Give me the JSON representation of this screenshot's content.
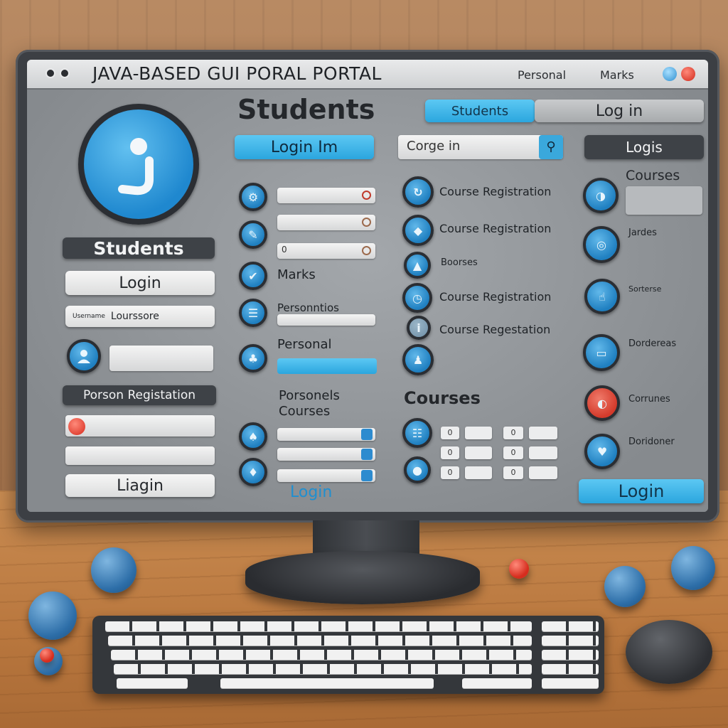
{
  "window": {
    "title": "JAVA-BASED GUI PORAL PORTAL",
    "nav_personal": "Personal",
    "nav_marks": "Marks"
  },
  "left": {
    "students_heading": "Students",
    "login_button": "Login",
    "field_loursstore": "Lourssore",
    "field_loursstore_prefix": "Username",
    "person_registration": "Porson Registation",
    "ligin_button": "Liagin"
  },
  "center": {
    "students_heading": "Students",
    "login_in_button": "Login Im",
    "marks_label": "Marks",
    "personal_label": "Personal",
    "persons_label": "Personntios",
    "personals_courses_label": "Porsonels Courses",
    "login_button": "Login",
    "field_zero": "0"
  },
  "right": {
    "students_tab": "Students",
    "login_tab": "Log in",
    "search_placeholder": "Corge in",
    "logis_button": "Logis",
    "course_registration_1": "Course Registration",
    "course_registration_2": "Course Registration",
    "course_reg_3": "Boorses",
    "course_registration_4": "Course Registration",
    "course_registration_5": "Course Regestation",
    "courses_heading": "Courses",
    "courses_title": "Courses",
    "jardes": "Jardes",
    "sorterse": "Sorterse",
    "docdereas": "Dordereas",
    "corrunes": "Corrunes",
    "doridoner": "Doridoner",
    "login_button": "Login"
  },
  "colors": {
    "accent": "#2ba6de",
    "bezel": "#3c3f44"
  }
}
